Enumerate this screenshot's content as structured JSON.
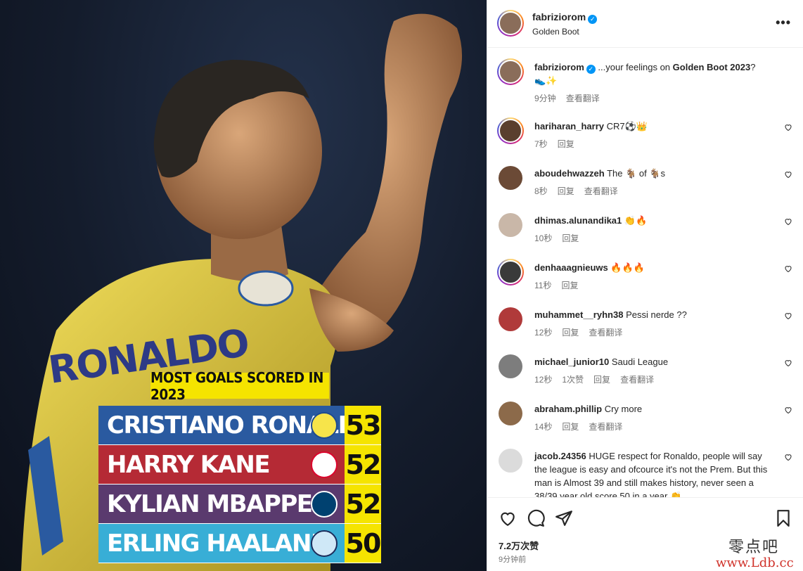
{
  "post_image": {
    "jersey_text": "RONALDO",
    "title": "MOST GOALS SCORED IN 2023",
    "rows": [
      {
        "name": "CRISTIANO RONALDO",
        "score": "53",
        "color": "#2a5aa0",
        "crest": "al-nassr-crest-icon"
      },
      {
        "name": "HARRY KANE",
        "score": "52",
        "color": "#b52a35",
        "crest": "bayern-crest-icon"
      },
      {
        "name": "KYLIAN MBAPPE",
        "score": "52",
        "color": "#5a3a6e",
        "crest": "psg-crest-icon"
      },
      {
        "name": "ERLING HAALAND",
        "score": "50",
        "color": "#38aed6",
        "crest": "man-city-crest-icon"
      }
    ],
    "accent": "#f5e400"
  },
  "header": {
    "username": "fabriziorom",
    "subtitle": "Golden Boot",
    "more_label": "•••"
  },
  "caption": {
    "username": "fabriziorom",
    "text_before": "...your feelings on ",
    "bold": "Golden Boot 2023",
    "text_after": "?",
    "emoji": "👟✨",
    "time": "9分钟",
    "translate": "查看翻译"
  },
  "comments": [
    {
      "username": "hariharan_harry",
      "text": "CR7⚽👑",
      "time": "7秒",
      "reply": "回复",
      "likes": "",
      "translate": ""
    },
    {
      "username": "aboudehwazzeh",
      "text": "The 🐐 of 🐐s",
      "time": "8秒",
      "reply": "回复",
      "likes": "",
      "translate": "查看翻译"
    },
    {
      "username": "dhimas.alunandika1",
      "text": "👏🔥",
      "time": "10秒",
      "reply": "回复",
      "likes": "",
      "translate": ""
    },
    {
      "username": "denhaaagnieuws",
      "text": "🔥🔥🔥",
      "time": "11秒",
      "reply": "回复",
      "likes": "",
      "translate": ""
    },
    {
      "username": "muhammet__ryhn38",
      "text": "Pessi nerde ??",
      "time": "12秒",
      "reply": "回复",
      "likes": "",
      "translate": "查看翻译"
    },
    {
      "username": "michael_junior10",
      "text": "Saudi League",
      "time": "12秒",
      "reply": "回复",
      "likes": "1次赞",
      "translate": "查看翻译"
    },
    {
      "username": "abraham.phillip",
      "text": "Cry more",
      "time": "14秒",
      "reply": "回复",
      "likes": "",
      "translate": "查看翻译"
    },
    {
      "username": "jacob.24356",
      "text": "HUGE respect for Ronaldo, people will say the league is easy and ofcource it's not the Prem. But this man is Almost 39 and still makes history, never seen a 38/39 year old score 50 in a year 👏",
      "time": "",
      "reply": "",
      "likes": "",
      "translate": ""
    }
  ],
  "footer": {
    "likes": "7.2万次赞",
    "time_ago": "9分钟前"
  },
  "watermark": {
    "line1": "零点吧",
    "line2": "www.Ldb.cc"
  }
}
